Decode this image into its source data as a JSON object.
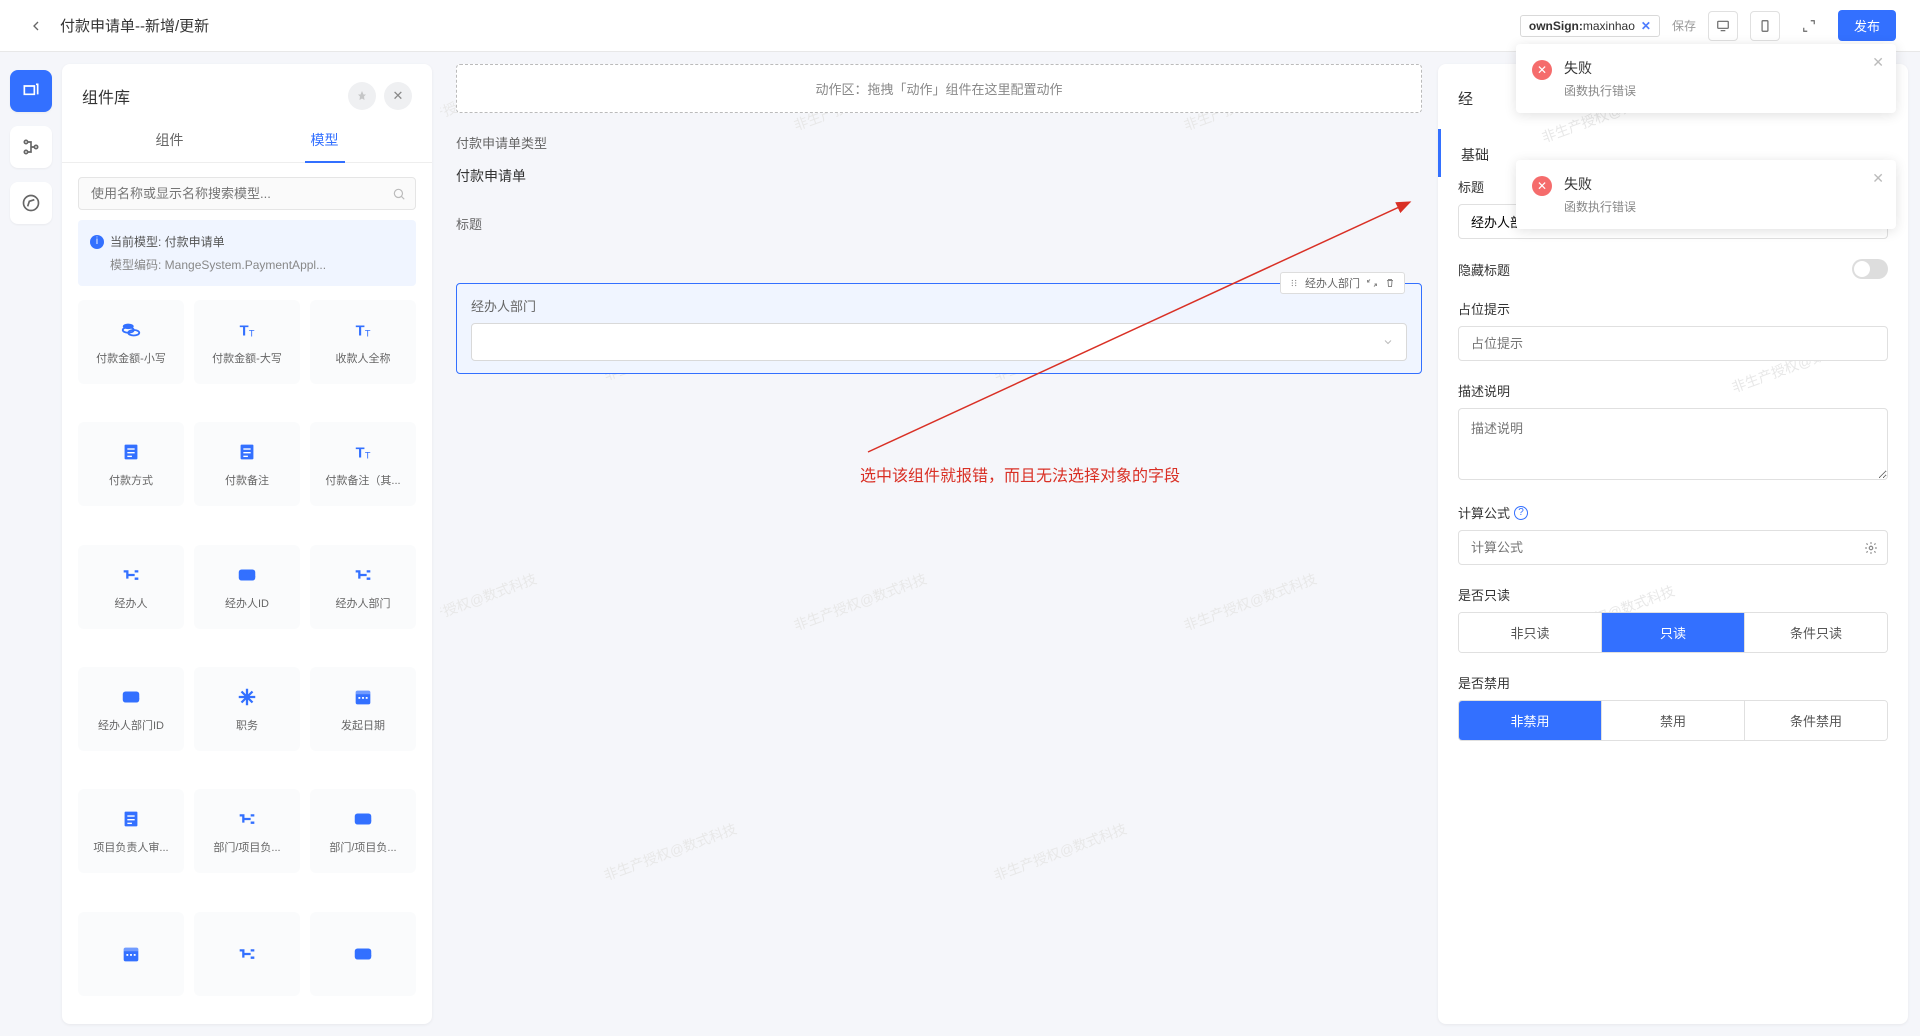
{
  "header": {
    "title": "付款申请单--新增/更新",
    "owner_sign_label": "ownSign:",
    "owner_sign_value": "maxinhao",
    "save_status": "保存",
    "publish_label": "发布"
  },
  "lib": {
    "title": "组件库",
    "tabs": {
      "components": "组件",
      "model": "模型"
    },
    "search_placeholder": "使用名称或显示名称搜索模型...",
    "model_current_label": "当前模型: ",
    "model_current_name": "付款申请单",
    "model_code_label": "模型编码: ",
    "model_code_value": "MangeSystem.PaymentAppl...",
    "cards": [
      {
        "label": "付款金额-小写",
        "icon": "coins"
      },
      {
        "label": "付款金额-大写",
        "icon": "text"
      },
      {
        "label": "收款人全称",
        "icon": "text"
      },
      {
        "label": "付款方式",
        "icon": "doc"
      },
      {
        "label": "付款备注",
        "icon": "doc"
      },
      {
        "label": "付款备注（其...",
        "icon": "text"
      },
      {
        "label": "经办人",
        "icon": "relation"
      },
      {
        "label": "经办人ID",
        "icon": "id"
      },
      {
        "label": "经办人部门",
        "icon": "relation"
      },
      {
        "label": "经办人部门ID",
        "icon": "id"
      },
      {
        "label": "职务",
        "icon": "struct"
      },
      {
        "label": "发起日期",
        "icon": "date"
      },
      {
        "label": "项目负责人审...",
        "icon": "doc"
      },
      {
        "label": "部门/项目负...",
        "icon": "relation"
      },
      {
        "label": "部门/项目负...",
        "icon": "id"
      },
      {
        "label": "",
        "icon": "date"
      },
      {
        "label": "",
        "icon": "relation"
      },
      {
        "label": "",
        "icon": "id"
      }
    ]
  },
  "canvas": {
    "action_zone": "动作区：拖拽「动作」组件在这里配置动作",
    "field_type_label": "付款申请单类型",
    "field_type_value": "付款申请单",
    "field_title_label": "标题",
    "selected_field_label": "经办人部门",
    "selected_badge_text": "经办人部门",
    "watermark_text": "非生产授权@数式科技",
    "annotation_text": "选中该组件就报错，而且无法选择对象的字段"
  },
  "panel": {
    "header_masked": "经",
    "section_basic": "基础",
    "label_title": "标题",
    "value_title": "经办人部门",
    "label_hide_title": "隐藏标题",
    "label_placeholder": "占位提示",
    "placeholder_placeholder": "占位提示",
    "label_description": "描述说明",
    "placeholder_description": "描述说明",
    "label_formula": "计算公式",
    "placeholder_formula": "计算公式",
    "label_readonly": "是否只读",
    "readonly_options": [
      "非只读",
      "只读",
      "条件只读"
    ],
    "readonly_active": 1,
    "label_disabled": "是否禁用",
    "disabled_options": [
      "非禁用",
      "禁用",
      "条件禁用"
    ],
    "disabled_active": 0
  },
  "toasts": [
    {
      "title": "失败",
      "msg": "函数执行错误"
    },
    {
      "title": "失败",
      "msg": "函数执行错误"
    }
  ]
}
